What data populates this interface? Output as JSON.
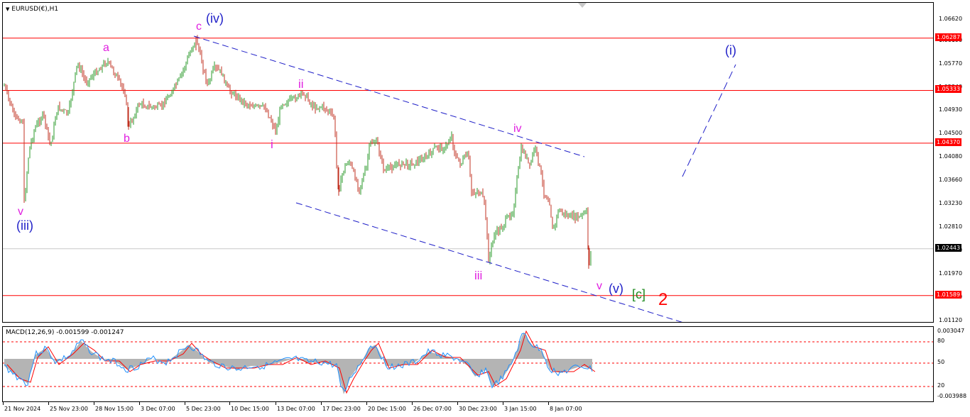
{
  "header": {
    "symbol_label": "EURUSD(€),H1",
    "macd_label": "MACD(12,26,9) -0.001599 -0.001247"
  },
  "price_axis": {
    "ticks": [
      "1.06620",
      "1.06190",
      "1.05770",
      "1.05340",
      "1.04930",
      "1.04500",
      "1.04080",
      "1.03660",
      "1.03230",
      "1.02810",
      "1.02390",
      "1.01970",
      "1.01540",
      "1.01120"
    ],
    "levels": [
      {
        "label": "1.06287",
        "value": 1.06287,
        "color": "#ff0000"
      },
      {
        "label": "1.05333",
        "value": 1.05333,
        "color": "#ff0000"
      },
      {
        "label": "1.04370",
        "value": 1.0437,
        "color": "#ff0000"
      },
      {
        "label": "1.01589",
        "value": 1.01589,
        "color": "#ff0000"
      }
    ],
    "current": {
      "label": "1.02443",
      "value": 1.02443
    }
  },
  "macd_axis": {
    "ticks": [
      "0.003047",
      "80",
      "50",
      "20",
      "-0.003988"
    ]
  },
  "time_axis": {
    "labels": [
      "21 Nov 2024",
      "25 Nov 23:00",
      "28 Nov 15:00",
      "3 Dec 07:00",
      "5 Dec 23:00",
      "10 Dec 15:00",
      "13 Dec 07:00",
      "17 Dec 23:00",
      "20 Dec 15:00",
      "26 Dec 07:00",
      "30 Dec 23:00",
      "3 Jan 15:00",
      "8 Jan 07:00"
    ]
  },
  "wave_labels": [
    {
      "text": "(iv)",
      "color": "#1f1fc8"
    },
    {
      "text": "c",
      "color": "#e020e0"
    },
    {
      "text": "a",
      "color": "#e020e0"
    },
    {
      "text": "b",
      "color": "#e020e0"
    },
    {
      "text": "ii",
      "color": "#e020e0"
    },
    {
      "text": "i",
      "color": "#e020e0"
    },
    {
      "text": "iv",
      "color": "#e020e0"
    },
    {
      "text": "iii",
      "color": "#e020e0"
    },
    {
      "text": "v",
      "color": "#e020e0"
    },
    {
      "text": "(iii)",
      "color": "#1f1fc8"
    },
    {
      "text": "v",
      "color": "#e020e0"
    },
    {
      "text": "(v)",
      "color": "#1f1fc8"
    },
    {
      "text": "[c]",
      "color": "#1f8a1f"
    },
    {
      "text": "2",
      "color": "#ff0000"
    },
    {
      "text": "(i)",
      "color": "#1f1fc8"
    }
  ],
  "colors": {
    "bull": "#2a9a2a",
    "bear": "#c03020",
    "level": "#ff0000",
    "channel": "#1f1fc8",
    "macd_signal": "#ff0000",
    "macd_main": "#1e90ff",
    "macd_hist": "#b4b4b4"
  }
}
